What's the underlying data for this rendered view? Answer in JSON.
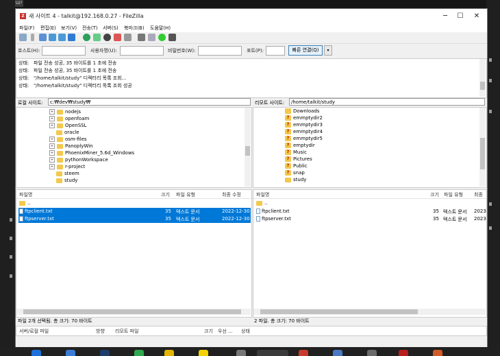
{
  "bg": {
    "tab_label": "Ш?Ш°Ш?"
  },
  "window": {
    "title": "새 사이트 4 - talkit@192.168.0.27 - FileZilla",
    "controls": {
      "minimize": "─",
      "maximize": "☐",
      "close": "✕"
    }
  },
  "menu": [
    "파일(F)",
    "편집(E)",
    "보기(V)",
    "전송(T)",
    "서버(S)",
    "북마크(B)",
    "도움말(H)"
  ],
  "quickconnect": {
    "host_label": "호스트(H):",
    "user_label": "사용자명(U):",
    "pass_label": "비밀번호(W):",
    "port_label": "포트(P):",
    "host_value": "",
    "user_value": "",
    "pass_value": "",
    "port_value": "",
    "connect_label": "빠른 연결(Q)",
    "dropdown": "▾"
  },
  "log": [
    {
      "label": "상태:",
      "text": "파일 전송 성공, 35 바이트를 1 초에 전송"
    },
    {
      "label": "상태:",
      "text": "파일 전송 성공, 35 바이트를 1 초에 전송"
    },
    {
      "label": "상태:",
      "text": "\"/home/talkit/study\" 디렉터리 목록 조회..."
    },
    {
      "label": "상태:",
      "text": "\"/home/talkit/study\" 디렉터리 목록 조회 성공"
    }
  ],
  "local": {
    "site_label": "로컬 사이트:",
    "path": "c:₩dev₩study₩",
    "tree": [
      {
        "name": "nodejs",
        "expandable": true
      },
      {
        "name": "openfoam",
        "expandable": true
      },
      {
        "name": "OpenSSL",
        "expandable": true
      },
      {
        "name": "oracle",
        "expandable": false
      },
      {
        "name": "osm-files",
        "expandable": true
      },
      {
        "name": "PanoplyWin",
        "expandable": true
      },
      {
        "name": "PhoenixMiner_5.6d_Windows",
        "expandable": true
      },
      {
        "name": "pythonWorkspace",
        "expandable": true
      },
      {
        "name": "r-project",
        "expandable": true
      },
      {
        "name": "steem",
        "expandable": false
      },
      {
        "name": "study",
        "expandable": false
      }
    ],
    "columns": {
      "name": "파일명",
      "size": "크기",
      "type": "파일 유형",
      "modified": "최종 수정"
    },
    "files": [
      {
        "name": "..",
        "size": "",
        "type": "",
        "modified": "",
        "selected": false,
        "folder": true
      },
      {
        "name": "ftpclient.txt",
        "size": "35",
        "type": "텍스트 문서",
        "modified": "2022-12-30",
        "selected": true,
        "folder": false
      },
      {
        "name": "ftpserver.txt",
        "size": "35",
        "type": "텍스트 문서",
        "modified": "2022-12-30",
        "selected": true,
        "folder": false
      }
    ],
    "status": "파일 2개 선택됨. 총 크기: 70 바이트"
  },
  "remote": {
    "site_label": "리모트 사이트:",
    "path": "/home/talkit/study",
    "tree": [
      {
        "name": "Downloads"
      },
      {
        "name": "emmptydir2"
      },
      {
        "name": "emmptydir3"
      },
      {
        "name": "emmptydir4"
      },
      {
        "name": "emmptydir5"
      },
      {
        "name": "emptydir"
      },
      {
        "name": "Music"
      },
      {
        "name": "Pictures"
      },
      {
        "name": "Public"
      },
      {
        "name": "snap"
      },
      {
        "name": "study"
      }
    ],
    "columns": {
      "name": "파일명",
      "size": "크기",
      "type": "파일 유형",
      "modified": "최종"
    },
    "files": [
      {
        "name": "..",
        "size": "",
        "type": "",
        "modified": "",
        "folder": true
      },
      {
        "name": "ftpclient.txt",
        "size": "35",
        "type": "텍스트 문서",
        "modified": "2023",
        "folder": false
      },
      {
        "name": "ftpserver.txt",
        "size": "35",
        "type": "텍스트 문서",
        "modified": "2023",
        "folder": false
      }
    ],
    "status": "2 파일. 총 크기: 70 바이트"
  },
  "queue": {
    "columns": {
      "server": "서버/로컬 파일",
      "direction": "방향",
      "remote": "리모트 파일",
      "size": "크기",
      "priority": "우선 ...",
      "status": "상태"
    }
  },
  "colors": {
    "selection": "#0078d7",
    "folder": "#f2c94c",
    "window_bg": "#f0f0f0"
  }
}
